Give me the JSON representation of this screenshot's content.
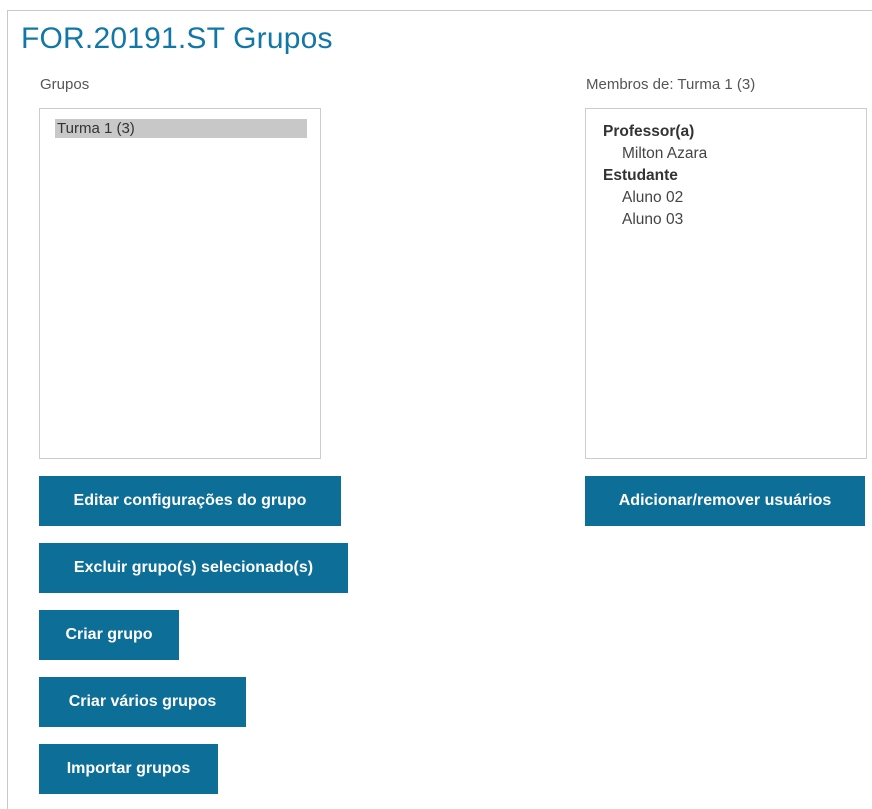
{
  "page_title": "FOR.20191.ST Grupos",
  "groups_panel": {
    "label": "Grupos",
    "options": [
      {
        "label": "Turma 1 (3)",
        "selected": true
      }
    ]
  },
  "members_panel": {
    "label": "Membros de: Turma 1 (3)",
    "roles": [
      {
        "role": "Professor(a)",
        "members": [
          "Milton Azara"
        ]
      },
      {
        "role": "Estudante",
        "members": [
          "Aluno 02",
          "Aluno 03"
        ]
      }
    ]
  },
  "buttons": {
    "edit_group": "Editar configurações do grupo",
    "delete_groups": "Excluir grupo(s) selecionado(s)",
    "create_group": "Criar grupo",
    "create_many": "Criar vários grupos",
    "import_groups": "Importar grupos",
    "add_remove_users": "Adicionar/remover usuários"
  },
  "colors": {
    "title": "#1177a8",
    "button_bg": "#0d6e97",
    "selection_bg": "#c8c8c8"
  }
}
